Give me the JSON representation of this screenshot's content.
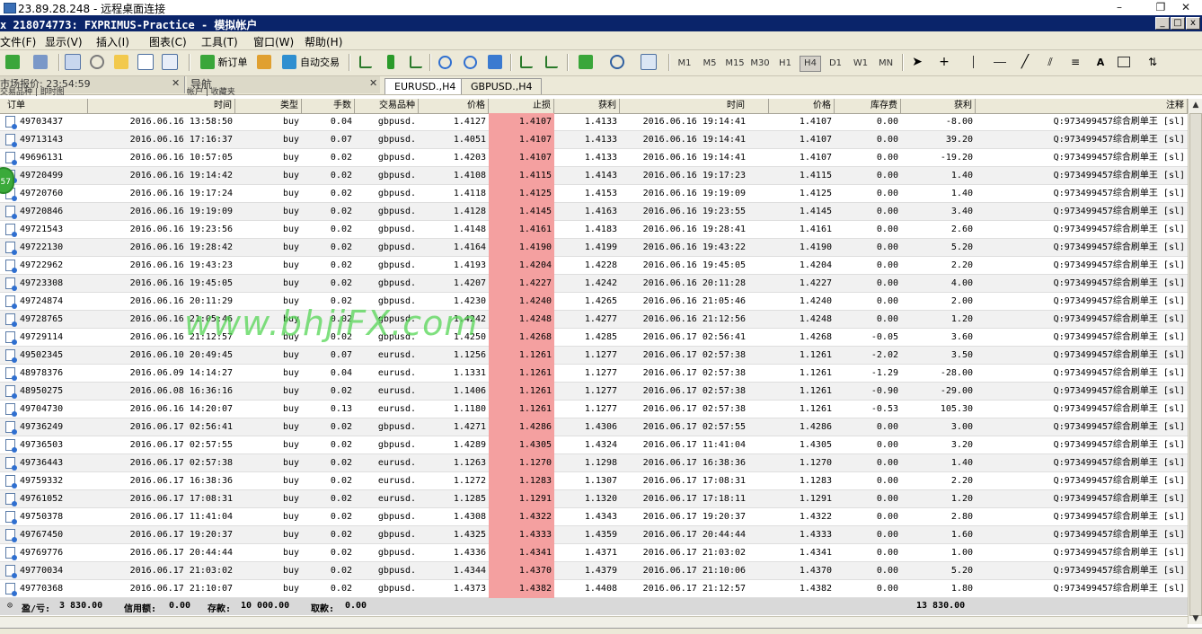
{
  "rdp": {
    "title": "23.89.28.248 - 远程桌面连接",
    "minimize": "–",
    "restore": "❐",
    "close": "✕"
  },
  "app": {
    "title": "x 218074773: FXPRIMUS-Practice - 模拟帐户"
  },
  "menu": [
    "文件(F)",
    "显示(V)",
    "插入(I)",
    "图表(C)",
    "工具(T)",
    "窗口(W)",
    "帮助(H)"
  ],
  "toolbar": {
    "new_order_label": "新订单",
    "auto_trade_label": "自动交易",
    "timeframes": [
      "M1",
      "M5",
      "M15",
      "M30",
      "H1",
      "H4",
      "D1",
      "W1",
      "MN"
    ],
    "active_timeframe": "H4",
    "text_tool_label": "A"
  },
  "panels": {
    "market_watch": "市场报价: 23:54:59",
    "market_watch_sub": "交易品种 | 即时图",
    "navigator": "导航",
    "navigator_sub": "帐户 | 收藏夹",
    "chart_tabs": [
      "EURUSD.,H4",
      "GBPUSD.,H4"
    ],
    "active_chart_tab": "EURUSD.,H4"
  },
  "columns": [
    "订单",
    "时间",
    "类型",
    "手数",
    "交易品种",
    "价格",
    "止损",
    "获利",
    "时间",
    "价格",
    "库存费",
    "获利",
    "注释"
  ],
  "rows": [
    [
      "49703437",
      "2016.06.16 13:58:50",
      "buy",
      "0.04",
      "gbpusd.",
      "1.4127",
      "1.4107",
      "1.4133",
      "2016.06.16 19:14:41",
      "1.4107",
      "0.00",
      "-8.00",
      "Q:973499457综合刷单王 [sl]"
    ],
    [
      "49713143",
      "2016.06.16 17:16:37",
      "buy",
      "0.07",
      "gbpusd.",
      "1.4051",
      "1.4107",
      "1.4133",
      "2016.06.16 19:14:41",
      "1.4107",
      "0.00",
      "39.20",
      "Q:973499457综合刷单王 [sl]"
    ],
    [
      "49696131",
      "2016.06.16 10:57:05",
      "buy",
      "0.02",
      "gbpusd.",
      "1.4203",
      "1.4107",
      "1.4133",
      "2016.06.16 19:14:41",
      "1.4107",
      "0.00",
      "-19.20",
      "Q:973499457综合刷单王 [sl]"
    ],
    [
      "49720499",
      "2016.06.16 19:14:42",
      "buy",
      "0.02",
      "gbpusd.",
      "1.4108",
      "1.4115",
      "1.4143",
      "2016.06.16 19:17:23",
      "1.4115",
      "0.00",
      "1.40",
      "Q:973499457综合刷单王 [sl]"
    ],
    [
      "49720760",
      "2016.06.16 19:17:24",
      "buy",
      "0.02",
      "gbpusd.",
      "1.4118",
      "1.4125",
      "1.4153",
      "2016.06.16 19:19:09",
      "1.4125",
      "0.00",
      "1.40",
      "Q:973499457综合刷单王 [sl]"
    ],
    [
      "49720846",
      "2016.06.16 19:19:09",
      "buy",
      "0.02",
      "gbpusd.",
      "1.4128",
      "1.4145",
      "1.4163",
      "2016.06.16 19:23:55",
      "1.4145",
      "0.00",
      "3.40",
      "Q:973499457综合刷单王 [sl]"
    ],
    [
      "49721543",
      "2016.06.16 19:23:56",
      "buy",
      "0.02",
      "gbpusd.",
      "1.4148",
      "1.4161",
      "1.4183",
      "2016.06.16 19:28:41",
      "1.4161",
      "0.00",
      "2.60",
      "Q:973499457综合刷单王 [sl]"
    ],
    [
      "49722130",
      "2016.06.16 19:28:42",
      "buy",
      "0.02",
      "gbpusd.",
      "1.4164",
      "1.4190",
      "1.4199",
      "2016.06.16 19:43:22",
      "1.4190",
      "0.00",
      "5.20",
      "Q:973499457综合刷单王 [sl]"
    ],
    [
      "49722962",
      "2016.06.16 19:43:23",
      "buy",
      "0.02",
      "gbpusd.",
      "1.4193",
      "1.4204",
      "1.4228",
      "2016.06.16 19:45:05",
      "1.4204",
      "0.00",
      "2.20",
      "Q:973499457综合刷单王 [sl]"
    ],
    [
      "49723308",
      "2016.06.16 19:45:05",
      "buy",
      "0.02",
      "gbpusd.",
      "1.4207",
      "1.4227",
      "1.4242",
      "2016.06.16 20:11:28",
      "1.4227",
      "0.00",
      "4.00",
      "Q:973499457综合刷单王 [sl]"
    ],
    [
      "49724874",
      "2016.06.16 20:11:29",
      "buy",
      "0.02",
      "gbpusd.",
      "1.4230",
      "1.4240",
      "1.4265",
      "2016.06.16 21:05:46",
      "1.4240",
      "0.00",
      "2.00",
      "Q:973499457综合刷单王 [sl]"
    ],
    [
      "49728765",
      "2016.06.16 21:05:46",
      "buy",
      "0.02",
      "gbpusd.",
      "1.4242",
      "1.4248",
      "1.4277",
      "2016.06.16 21:12:56",
      "1.4248",
      "0.00",
      "1.20",
      "Q:973499457综合刷单王 [sl]"
    ],
    [
      "49729114",
      "2016.06.16 21:12:57",
      "buy",
      "0.02",
      "gbpusd.",
      "1.4250",
      "1.4268",
      "1.4285",
      "2016.06.17 02:56:41",
      "1.4268",
      "-0.05",
      "3.60",
      "Q:973499457综合刷单王 [sl]"
    ],
    [
      "49502345",
      "2016.06.10 20:49:45",
      "buy",
      "0.07",
      "eurusd.",
      "1.1256",
      "1.1261",
      "1.1277",
      "2016.06.17 02:57:38",
      "1.1261",
      "-2.02",
      "3.50",
      "Q:973499457综合刷单王 [sl]"
    ],
    [
      "48978376",
      "2016.06.09 14:14:27",
      "buy",
      "0.04",
      "eurusd.",
      "1.1331",
      "1.1261",
      "1.1277",
      "2016.06.17 02:57:38",
      "1.1261",
      "-1.29",
      "-28.00",
      "Q:973499457综合刷单王 [sl]"
    ],
    [
      "48950275",
      "2016.06.08 16:36:16",
      "buy",
      "0.02",
      "eurusd.",
      "1.1406",
      "1.1261",
      "1.1277",
      "2016.06.17 02:57:38",
      "1.1261",
      "-0.90",
      "-29.00",
      "Q:973499457综合刷单王 [sl]"
    ],
    [
      "49704730",
      "2016.06.16 14:20:07",
      "buy",
      "0.13",
      "eurusd.",
      "1.1180",
      "1.1261",
      "1.1277",
      "2016.06.17 02:57:38",
      "1.1261",
      "-0.53",
      "105.30",
      "Q:973499457综合刷单王 [sl]"
    ],
    [
      "49736249",
      "2016.06.17 02:56:41",
      "buy",
      "0.02",
      "gbpusd.",
      "1.4271",
      "1.4286",
      "1.4306",
      "2016.06.17 02:57:55",
      "1.4286",
      "0.00",
      "3.00",
      "Q:973499457综合刷单王 [sl]"
    ],
    [
      "49736503",
      "2016.06.17 02:57:55",
      "buy",
      "0.02",
      "gbpusd.",
      "1.4289",
      "1.4305",
      "1.4324",
      "2016.06.17 11:41:04",
      "1.4305",
      "0.00",
      "3.20",
      "Q:973499457综合刷单王 [sl]"
    ],
    [
      "49736443",
      "2016.06.17 02:57:38",
      "buy",
      "0.02",
      "eurusd.",
      "1.1263",
      "1.1270",
      "1.1298",
      "2016.06.17 16:38:36",
      "1.1270",
      "0.00",
      "1.40",
      "Q:973499457综合刷单王 [sl]"
    ],
    [
      "49759332",
      "2016.06.17 16:38:36",
      "buy",
      "0.02",
      "eurusd.",
      "1.1272",
      "1.1283",
      "1.1307",
      "2016.06.17 17:08:31",
      "1.1283",
      "0.00",
      "2.20",
      "Q:973499457综合刷单王 [sl]"
    ],
    [
      "49761052",
      "2016.06.17 17:08:31",
      "buy",
      "0.02",
      "eurusd.",
      "1.1285",
      "1.1291",
      "1.1320",
      "2016.06.17 17:18:11",
      "1.1291",
      "0.00",
      "1.20",
      "Q:973499457综合刷单王 [sl]"
    ],
    [
      "49750378",
      "2016.06.17 11:41:04",
      "buy",
      "0.02",
      "gbpusd.",
      "1.4308",
      "1.4322",
      "1.4343",
      "2016.06.17 19:20:37",
      "1.4322",
      "0.00",
      "2.80",
      "Q:973499457综合刷单王 [sl]"
    ],
    [
      "49767450",
      "2016.06.17 19:20:37",
      "buy",
      "0.02",
      "gbpusd.",
      "1.4325",
      "1.4333",
      "1.4359",
      "2016.06.17 20:44:44",
      "1.4333",
      "0.00",
      "1.60",
      "Q:973499457综合刷单王 [sl]"
    ],
    [
      "49769776",
      "2016.06.17 20:44:44",
      "buy",
      "0.02",
      "gbpusd.",
      "1.4336",
      "1.4341",
      "1.4371",
      "2016.06.17 21:03:02",
      "1.4341",
      "0.00",
      "1.00",
      "Q:973499457综合刷单王 [sl]"
    ],
    [
      "49770034",
      "2016.06.17 21:03:02",
      "buy",
      "0.02",
      "gbpusd.",
      "1.4344",
      "1.4370",
      "1.4379",
      "2016.06.17 21:10:06",
      "1.4370",
      "0.00",
      "5.20",
      "Q:973499457综合刷单王 [sl]"
    ],
    [
      "49770368",
      "2016.06.17 21:10:07",
      "buy",
      "0.02",
      "gbpusd.",
      "1.4373",
      "1.4382",
      "1.4408",
      "2016.06.17 21:12:57",
      "1.4382",
      "0.00",
      "1.80",
      "Q:973499457综合刷单王 [sl]"
    ]
  ],
  "summary": {
    "pl_label": "盈/亏:",
    "pl_value": "3 830.00",
    "credit_label": "信用额:",
    "credit_value": "0.00",
    "deposit_label": "存款:",
    "deposit_value": "10 000.00",
    "withdraw_label": "取款:",
    "withdraw_value": "0.00",
    "balance": "13 830.00"
  },
  "watermark": "www.bhjiFX.com",
  "badge": "57",
  "colors": {
    "stop_loss_bg": "#f4a0a0",
    "title_bar": "#0a246a",
    "menu_bg": "#ece9d8"
  }
}
